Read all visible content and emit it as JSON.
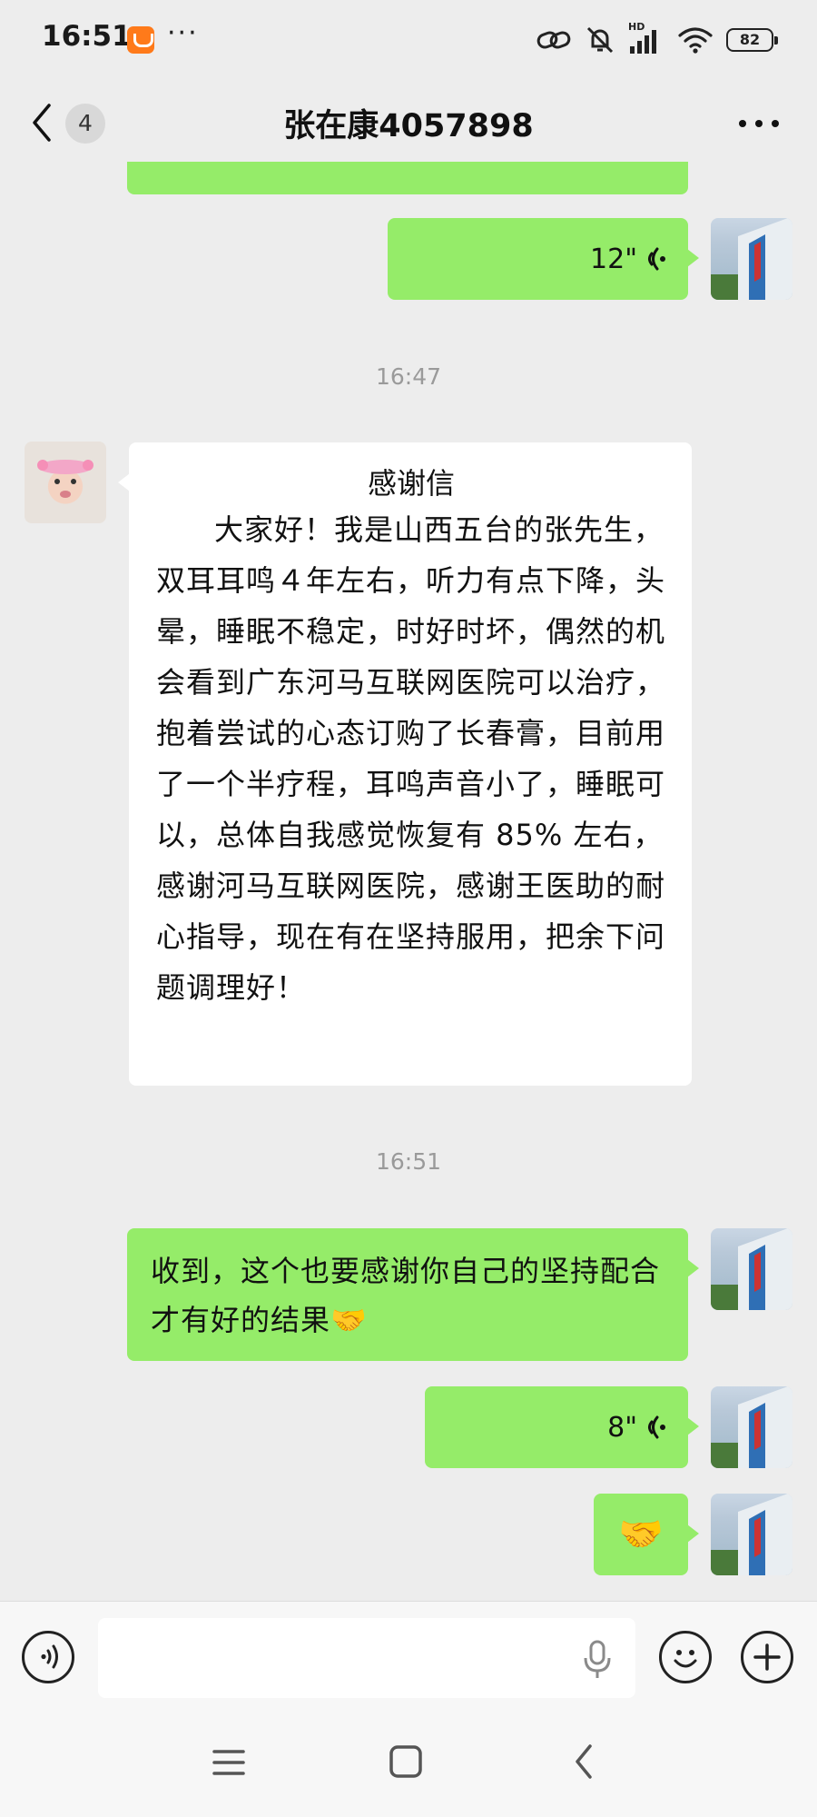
{
  "status_bar": {
    "time": "16:51",
    "more": "···",
    "network": "HD",
    "battery": "82",
    "icons": [
      "app-notification-icon",
      "link-icon",
      "mute-bell-icon",
      "signal-icon",
      "wifi-icon",
      "battery-icon"
    ]
  },
  "header": {
    "unread_count": "4",
    "title": "张在康4057898",
    "icons": [
      "back-chevron-icon",
      "more-dots-icon"
    ]
  },
  "messages": [
    {
      "type": "voice",
      "side": "right",
      "duration": "12\""
    },
    {
      "type": "timestamp",
      "text": "16:47"
    },
    {
      "type": "text",
      "side": "left",
      "title": "感谢信",
      "body": "大家好！我是山西五台的张先生，双耳耳鸣４年左右，听力有点下降，头晕，睡眠不稳定，时好时坏，偶然的机会看到广东河马互联网医院可以治疗，抱着尝试的心态订购了长春膏，目前用了一个半疗程，耳鸣声音小了，睡眠可以，总体自我感觉恢复有 85% 左右，感谢河马互联网医院，感谢王医助的耐心指导，现在有在坚持服用，把余下问题调理好！"
    },
    {
      "type": "timestamp",
      "text": "16:51"
    },
    {
      "type": "text",
      "side": "right",
      "body": "收到，这个也要感谢你自己的坚持配合才有好的结果🤝"
    },
    {
      "type": "voice",
      "side": "right",
      "duration": "8\""
    },
    {
      "type": "emoji",
      "side": "right",
      "body": "🤝"
    }
  ],
  "input_bar": {
    "value": "",
    "icons": [
      "voice-mode-icon",
      "microphone-icon",
      "emoji-face-icon",
      "plus-icon"
    ]
  },
  "colors": {
    "background": "#ededed",
    "sent_bubble": "#95ec69",
    "received_bubble": "#ffffff"
  }
}
